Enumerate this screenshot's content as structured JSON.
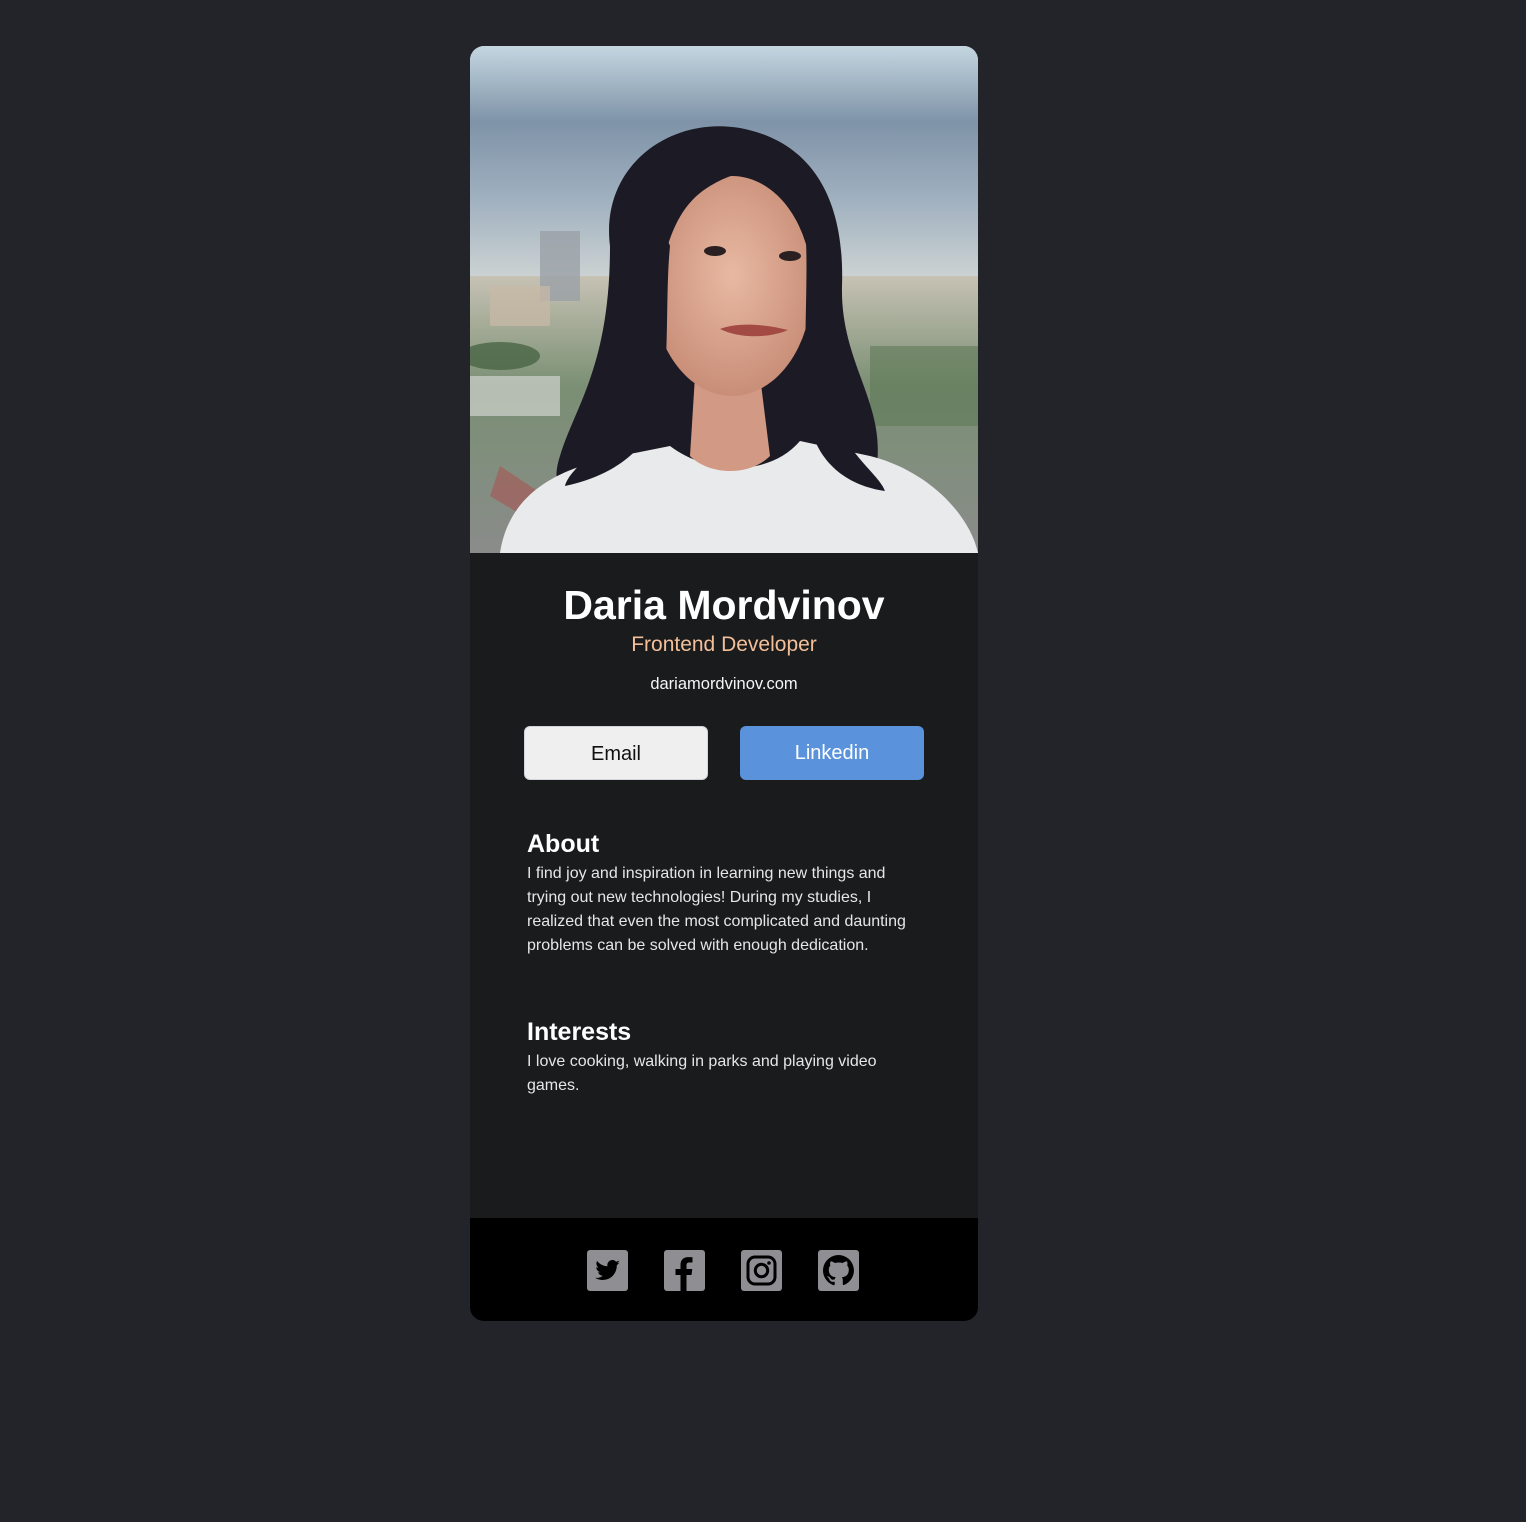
{
  "profile": {
    "name": "Daria Mordvinov",
    "title": "Frontend Developer",
    "website": "dariamordvinov.com",
    "photo_icon": "portrait-photo"
  },
  "buttons": {
    "email_label": "Email",
    "linkedin_label": "Linkedin"
  },
  "about": {
    "heading": "About",
    "text": "I find joy and inspiration in learning new things and trying out new technologies! During my studies, I realized that even the most complicated and daunting problems can be solved with enough dedication."
  },
  "interests": {
    "heading": "Interests",
    "text": "I love cooking, walking in parks and playing video games."
  },
  "footer": {
    "social_icons": [
      "twitter-icon",
      "facebook-icon",
      "instagram-icon",
      "github-icon"
    ]
  },
  "colors": {
    "page_background": "#23242a",
    "card_background": "#1a1b1d",
    "footer_background": "#000000",
    "title_accent": "#f3bf99",
    "linkedin_button": "#5a93db",
    "email_button": "#efefef",
    "social_icon": "#8e8e93"
  }
}
